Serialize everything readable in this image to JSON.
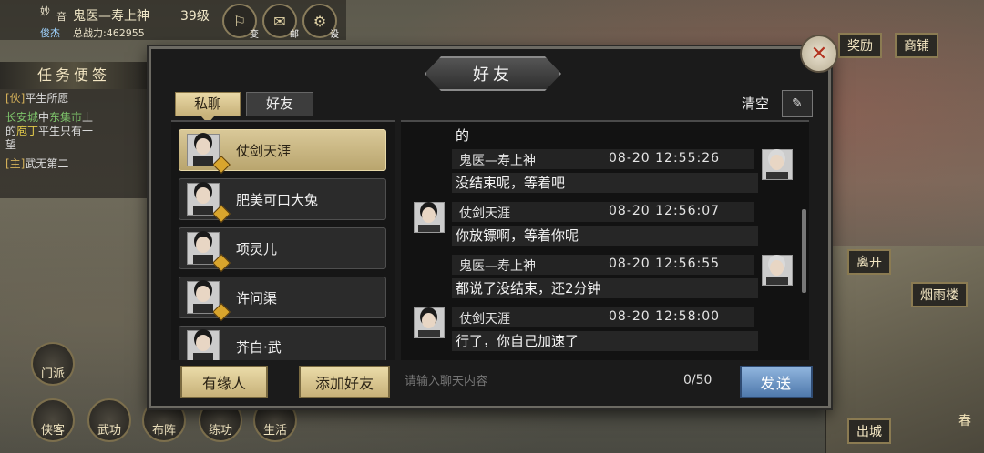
{
  "hud": {
    "name_prefix": "妙",
    "name_suffix": "音",
    "role": "鬼医—寿上神",
    "level": "39级",
    "title": "俊杰",
    "power": "总战力:462955",
    "icons": [
      {
        "icon": "hat-icon",
        "label": "变"
      },
      {
        "icon": "mail-icon",
        "label": "邮"
      },
      {
        "icon": "gear-icon",
        "label": "设"
      }
    ],
    "reward_label": "奖励",
    "shop_label": "商铺"
  },
  "side": {
    "header": "任务便签",
    "quests": [
      {
        "tag": "[伙]",
        "name": "平生所愿"
      },
      {
        "loc": "长安城",
        "mid": "中",
        "loc2": "东集市",
        "rest": "上",
        "line2": "的",
        "npc": "庖丁",
        "line2b": "平生只有一",
        "line3": "望"
      },
      {
        "tag": "[主]",
        "name": "武无第二"
      }
    ],
    "icons": [
      {
        "icon": "sect-icon",
        "label": "门派"
      },
      {
        "icon": "xiake-icon",
        "label": "侠客"
      },
      {
        "icon": "martial-icon",
        "label": "武功"
      },
      {
        "icon": "formation-icon",
        "label": "布阵"
      },
      {
        "icon": "craft-icon",
        "label": "练功"
      },
      {
        "icon": "life-icon",
        "label": "生活"
      }
    ]
  },
  "right": {
    "leave_label": "离开",
    "place_label": "烟雨楼",
    "exit_label": "出城",
    "season": "春"
  },
  "dialog": {
    "title": "好友",
    "tabs": [
      "私聊",
      "好友"
    ],
    "clear_label": "清空",
    "friends": [
      {
        "name": "仗剑天涯",
        "selected": true
      },
      {
        "name": "肥美可口大兔"
      },
      {
        "name": "项灵儿"
      },
      {
        "name": "许问渠"
      },
      {
        "name": "芥白·武"
      }
    ],
    "chat_partial": "的",
    "messages": [
      {
        "side": "right",
        "sender": "鬼医—寿上神",
        "time": "08-20 12:55:26",
        "text": "没结束呢，等着吧"
      },
      {
        "side": "left",
        "sender": "仗剑天涯",
        "time": "08-20 12:56:07",
        "text": "你放镖啊，等着你呢"
      },
      {
        "side": "right",
        "sender": "鬼医—寿上神",
        "time": "08-20 12:56:55",
        "text": "都说了没结束，还2分钟"
      },
      {
        "side": "left",
        "sender": "仗剑天涯",
        "time": "08-20 12:58:00",
        "text": "行了，你自己加速了"
      }
    ],
    "buttons": {
      "fate": "有缘人",
      "add_friend": "添加好友",
      "send": "发送"
    },
    "input_placeholder": "请输入聊天内容",
    "counter": "0/50"
  }
}
